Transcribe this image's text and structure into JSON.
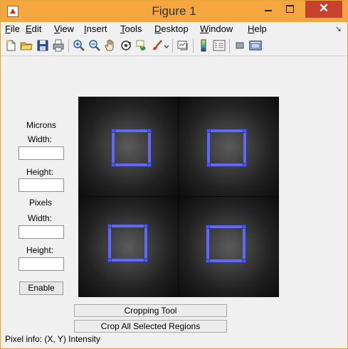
{
  "window": {
    "title": "Figure 1",
    "close_glyph": "✕"
  },
  "menu": [
    {
      "accel": "F",
      "rest": "ile"
    },
    {
      "accel": "E",
      "rest": "dit"
    },
    {
      "accel": "V",
      "rest": "iew"
    },
    {
      "accel": "I",
      "rest": "nsert"
    },
    {
      "accel": "T",
      "rest": "ools"
    },
    {
      "accel": "D",
      "rest": "esktop"
    },
    {
      "accel": "W",
      "rest": "indow"
    },
    {
      "accel": "H",
      "rest": "elp"
    }
  ],
  "menu_overflow_glyph": "↘",
  "toolbar_icons": [
    "new-figure-icon",
    "open-file-icon",
    "save-icon",
    "print-icon",
    "zoom-in-icon",
    "zoom-out-icon",
    "pan-icon",
    "rotate-3d-icon",
    "data-cursor-icon",
    "brush-icon",
    "brush-dropdown-icon",
    "link-plot-icon",
    "colorbar-icon",
    "legend-icon",
    "hide-plot-tools-icon",
    "show-plot-tools-icon"
  ],
  "side_panel": {
    "microns_label": "Microns",
    "microns_width_label": "Width:",
    "microns_width_value": "",
    "microns_height_label": "Height:",
    "microns_height_value": "",
    "pixels_label": "Pixels",
    "pixels_width_label": "Width:",
    "pixels_width_value": "",
    "pixels_height_label": "Height:",
    "pixels_height_value": "",
    "enable_button": "Enable"
  },
  "image": {
    "roi_color": "#5f6af0",
    "roi_count": 4
  },
  "buttons": {
    "cropping_tool": "Cropping Tool",
    "crop_all": "Crop All Selected Regions"
  },
  "status": {
    "text": "Pixel info: (X, Y)  Intensity"
  },
  "colors": {
    "titlebar": "#f6a63f",
    "close": "#c7412f",
    "panel": "#f0f0f0"
  }
}
